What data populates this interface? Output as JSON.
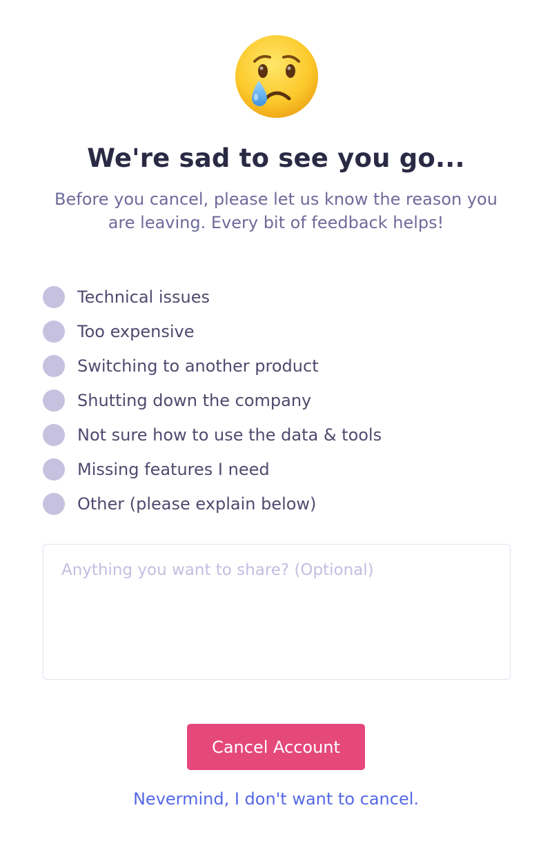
{
  "header": {
    "emoji_icon": "crying-face-icon",
    "title": "We're sad to see you go...",
    "subtitle": "Before you cancel, please let us know the reason you are leaving. Every bit of feedback helps!"
  },
  "reasons": [
    {
      "label": "Technical issues",
      "selected": false
    },
    {
      "label": "Too expensive",
      "selected": false
    },
    {
      "label": "Switching to another product",
      "selected": false
    },
    {
      "label": "Shutting down the company",
      "selected": false
    },
    {
      "label": "Not sure how to use the data & tools",
      "selected": false
    },
    {
      "label": "Missing features I need",
      "selected": false
    },
    {
      "label": "Other (please explain below)",
      "selected": false
    }
  ],
  "feedback": {
    "value": "",
    "placeholder": "Anything you want to share? (Optional)"
  },
  "actions": {
    "cancel_label": "Cancel Account",
    "nevermind_label": "Nevermind, I don't want to cancel."
  },
  "colors": {
    "accent": "#e5487b",
    "link": "#5468e6",
    "radio": "#c5c1df",
    "title": "#2b2a45",
    "text": "#4e4a6e"
  }
}
